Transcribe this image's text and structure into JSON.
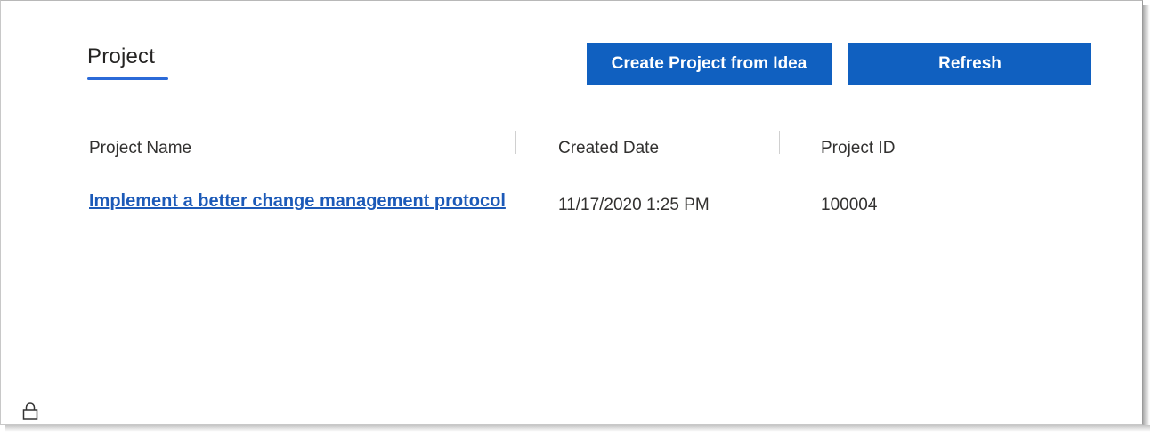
{
  "tab": {
    "label": "Project"
  },
  "toolbar": {
    "create_label": "Create Project from Idea",
    "refresh_label": "Refresh"
  },
  "table": {
    "columns": [
      "Project Name",
      "Created Date",
      "Project ID"
    ],
    "rows": [
      {
        "name": "Implement a better change management protocol",
        "created": "11/17/2020 1:25 PM",
        "id": "100004"
      }
    ]
  },
  "icons": {
    "footer": "lock-icon"
  },
  "colors": {
    "accent": "#1060c0",
    "link": "#1c5ab8",
    "tab_underline": "#2b6ad8"
  }
}
